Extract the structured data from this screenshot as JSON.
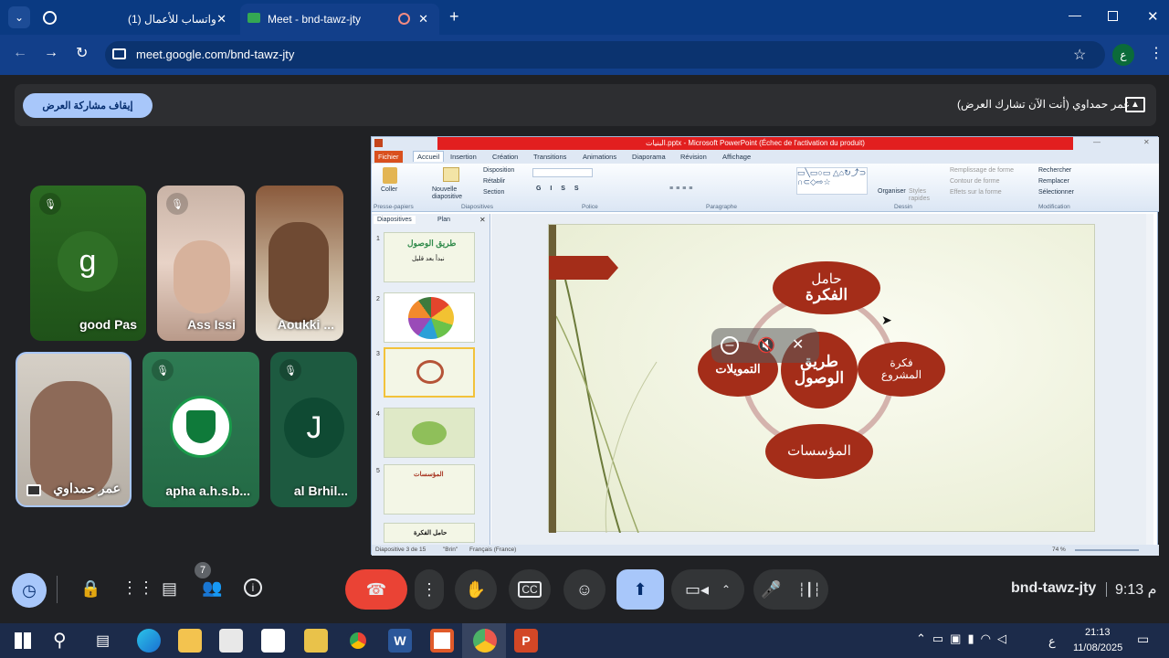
{
  "browser": {
    "tabs": [
      {
        "title": "(1) واتساب للأعمال"
      },
      {
        "title": "Meet - bnd-tawz-jty"
      }
    ],
    "url": "meet.google.com/bnd-tawz-jty",
    "profile_letter": "ع",
    "new_tab": "+",
    "close": "✕"
  },
  "meet": {
    "stop_sharing": "إيقاف مشاركة العرض",
    "presenting_info": "عمر حمداوي (أنت الآن تشارك العرض)",
    "participants": [
      {
        "name": "good Pas",
        "initial": "g"
      },
      {
        "name": "Ass Issi"
      },
      {
        "name": "Aoukki ..."
      },
      {
        "name": "عمر حمداوي"
      },
      {
        "name": "apha a.h.s.b..."
      },
      {
        "name": "al Brhil...",
        "initial": "J"
      }
    ],
    "meeting_code": "bnd-tawz-jty",
    "time": "9:13 م",
    "participants_count": "7"
  },
  "ppt": {
    "title_bar": "البنيات.pptx - Microsoft PowerPoint (Échec de l'activation du produit)",
    "tabs": [
      "Fichier",
      "Accueil",
      "Insertion",
      "Création",
      "Transitions",
      "Animations",
      "Diaporama",
      "Révision",
      "Affichage"
    ],
    "ribbon": {
      "coller": "Coller",
      "nouvelle": "Nouvelle diapositive",
      "disposition": "Disposition",
      "retablir": "Rétablir",
      "section": "Section",
      "organiser": "Organiser",
      "styles": "Styles rapides",
      "remplissage": "Remplissage de forme",
      "contour": "Contour de forme",
      "effets": "Effets sur la forme",
      "rechercher": "Rechercher",
      "remplacer": "Remplacer",
      "selectionner": "Sélectionner",
      "groups": [
        "Presse-papiers",
        "Diapositives",
        "Police",
        "Paragraphe",
        "Dessin",
        "Modification"
      ]
    },
    "panel_tabs": [
      "Diapositives",
      "Plan"
    ],
    "thumb1_title": "طريق الوصول",
    "thumb1_sub": "نبدأ بعد قليل",
    "thumb5_title": "المؤسسات",
    "thumb_last": "حامل الفكرة",
    "slide": {
      "top_1": "حامل",
      "top_2": "الفكرة",
      "center_1": "طريق",
      "center_2": "الوصول",
      "right_1": "فكرة",
      "right_2": "المشروع",
      "left": "التمويلات",
      "bottom": "المؤسسات"
    },
    "status": {
      "slide": "Diapositive 3 de 15",
      "theme": "\"Brin\"",
      "lang": "Français (France)",
      "zoom": "74 %"
    }
  },
  "taskbar": {
    "time": "21:13",
    "date": "11/08/2025",
    "lang": "ع"
  },
  "colors": {
    "accent": "#a8c7fa",
    "end_call": "#ea4335",
    "oval": "#a42d19"
  }
}
